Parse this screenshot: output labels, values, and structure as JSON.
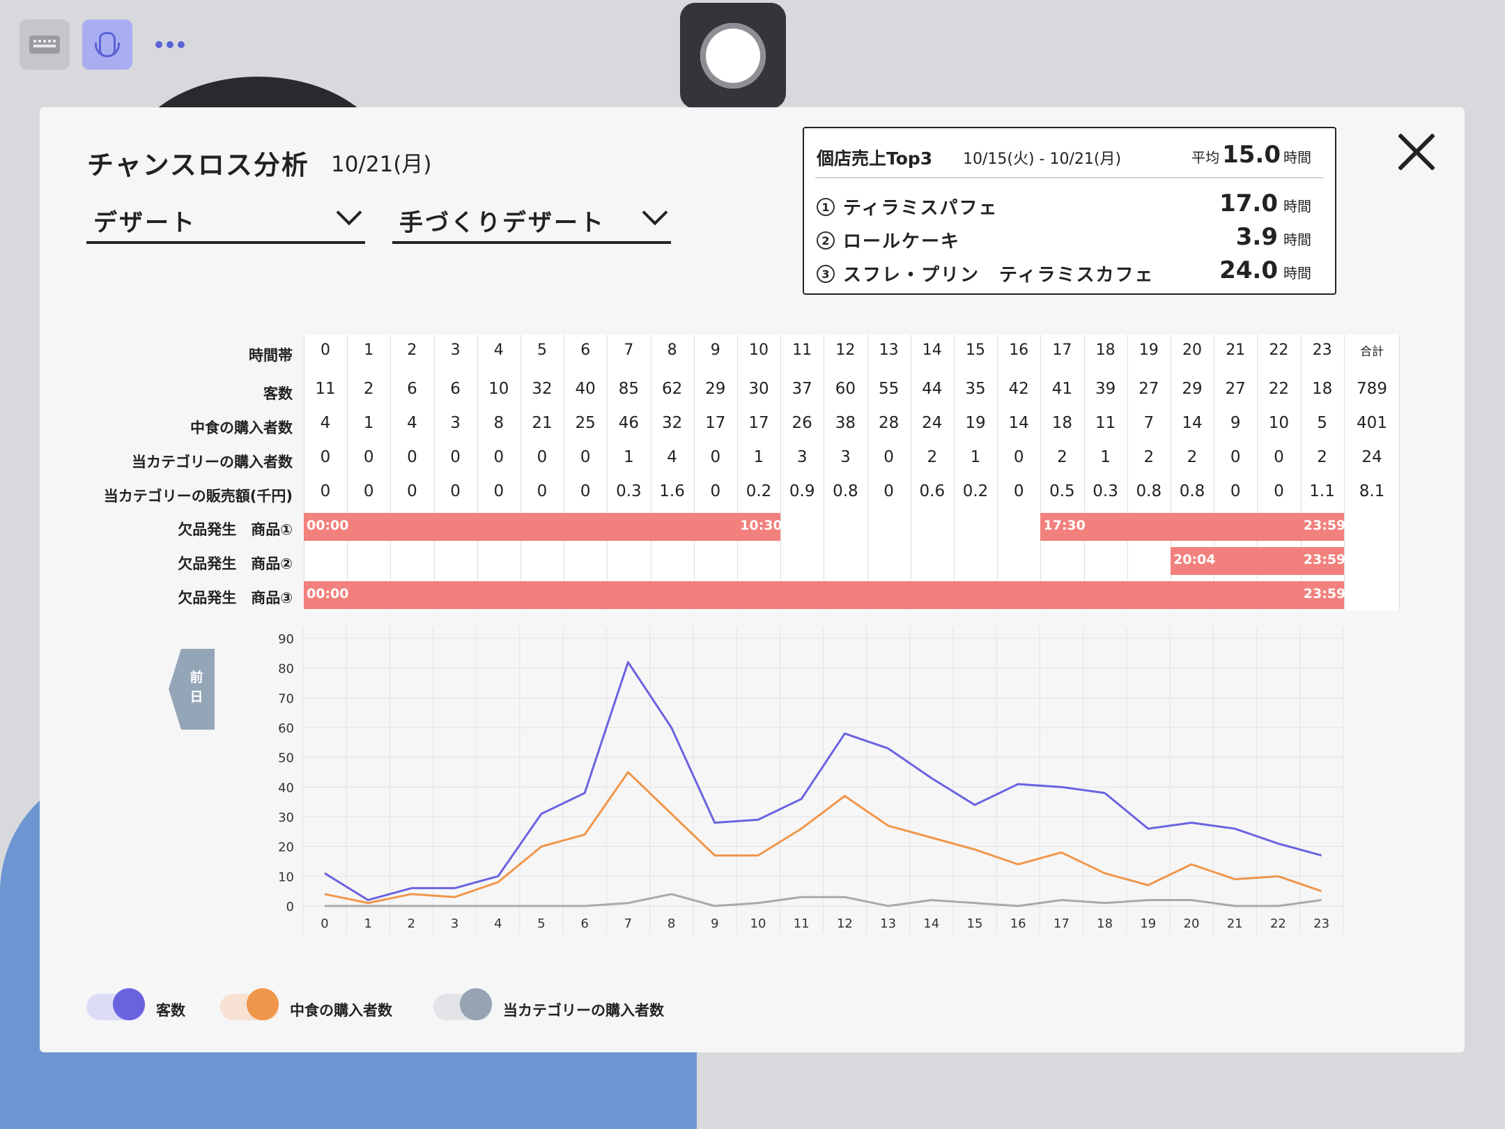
{
  "toolbar": {
    "keyboard_icon": "keyboard-icon",
    "mic_icon": "microphone-icon",
    "more_icon": "more-dots-icon",
    "record_icon": "record-icon"
  },
  "header": {
    "title": "チャンスロス分析",
    "date": "10/21(月)"
  },
  "filters": {
    "category": "デザート",
    "subcategory": "手づくりデザート"
  },
  "top3": {
    "title": "個店売上Top3",
    "range": "10/15(火) - 10/21(月)",
    "avg_label": "平均",
    "avg_value": "15.0",
    "unit": "時間",
    "items": [
      {
        "rank": "1",
        "name": "ティラミスパフェ",
        "value": "17.0"
      },
      {
        "rank": "2",
        "name": "ロールケーキ",
        "value": "3.9"
      },
      {
        "rank": "3",
        "name": "スフレ・プリン　ティラミスカフェ",
        "value": "24.0"
      }
    ]
  },
  "table": {
    "row_labels": {
      "hours": "時間帯",
      "customers": "客数",
      "lunch": "中食の購入者数",
      "category": "当カテゴリーの購入者数",
      "sales": "当カテゴリーの販売額(千円)",
      "stock1": "欠品発生　商品①",
      "stock2": "欠品発生　商品②",
      "stock3": "欠品発生　商品③"
    },
    "hours": [
      "0",
      "1",
      "2",
      "3",
      "4",
      "5",
      "6",
      "7",
      "8",
      "9",
      "10",
      "11",
      "12",
      "13",
      "14",
      "15",
      "16",
      "17",
      "18",
      "19",
      "20",
      "21",
      "22",
      "23"
    ],
    "sum_label": "合計",
    "customers": [
      "11",
      "2",
      "6",
      "6",
      "10",
      "32",
      "40",
      "85",
      "62",
      "29",
      "30",
      "37",
      "60",
      "55",
      "44",
      "35",
      "42",
      "41",
      "39",
      "27",
      "29",
      "27",
      "22",
      "18"
    ],
    "customers_total": "789",
    "lunch": [
      "4",
      "1",
      "4",
      "3",
      "8",
      "21",
      "25",
      "46",
      "32",
      "17",
      "17",
      "26",
      "38",
      "28",
      "24",
      "19",
      "14",
      "18",
      "11",
      "7",
      "14",
      "9",
      "10",
      "5"
    ],
    "lunch_total": "401",
    "category": [
      "0",
      "0",
      "0",
      "0",
      "0",
      "0",
      "0",
      "1",
      "4",
      "0",
      "1",
      "3",
      "3",
      "0",
      "2",
      "1",
      "0",
      "2",
      "1",
      "2",
      "2",
      "0",
      "0",
      "2"
    ],
    "category_total": "24",
    "sales": [
      "0",
      "0",
      "0",
      "0",
      "0",
      "0",
      "0",
      "0.3",
      "1.6",
      "0",
      "0.2",
      "0.9",
      "0.8",
      "0",
      "0.6",
      "0.2",
      "0",
      "0.5",
      "0.3",
      "0.8",
      "0.8",
      "0",
      "0",
      "1.1"
    ],
    "sales_total": "8.1",
    "stockouts": [
      {
        "segments": [
          {
            "from": 0,
            "to": 10.99,
            "start": "00:00",
            "end": "10:30"
          },
          {
            "from": 17,
            "to": 23.99,
            "start": "17:30",
            "end": "23:59"
          }
        ]
      },
      {
        "segments": [
          {
            "from": 20,
            "to": 23.99,
            "start": "20:04",
            "end": "23:59"
          }
        ]
      },
      {
        "segments": [
          {
            "from": 0,
            "to": 23.99,
            "start": "00:00",
            "end": "23:59"
          }
        ]
      }
    ]
  },
  "prev_day": {
    "label": "前日",
    "icon": "chevron-left-icon"
  },
  "chart_data": {
    "type": "line",
    "x": [
      0,
      1,
      2,
      3,
      4,
      5,
      6,
      7,
      8,
      9,
      10,
      11,
      12,
      13,
      14,
      15,
      16,
      17,
      18,
      19,
      20,
      21,
      22,
      23
    ],
    "ylim": [
      0,
      90
    ],
    "yticks": [
      0,
      10,
      20,
      30,
      40,
      50,
      60,
      70,
      80,
      90
    ],
    "grid": true,
    "series": [
      {
        "name": "客数",
        "color": "#6a63e0",
        "values": [
          11,
          2,
          6,
          6,
          10,
          31,
          38,
          82,
          60,
          28,
          29,
          36,
          58,
          53,
          43,
          34,
          41,
          40,
          38,
          26,
          28,
          26,
          21,
          17
        ]
      },
      {
        "name": "中食の購入者数",
        "color": "#f0964a",
        "values": [
          4,
          1,
          4,
          3,
          8,
          20,
          24,
          45,
          31,
          17,
          17,
          26,
          37,
          27,
          23,
          19,
          14,
          18,
          11,
          7,
          14,
          9,
          10,
          5
        ]
      },
      {
        "name": "当カテゴリーの購入者数",
        "color": "#a9a9ad",
        "values": [
          0,
          0,
          0,
          0,
          0,
          0,
          0,
          1,
          4,
          0,
          1,
          3,
          3,
          0,
          2,
          1,
          0,
          2,
          1,
          2,
          2,
          0,
          0,
          2
        ]
      }
    ]
  },
  "legend": [
    {
      "label": "客数",
      "color": "#6a63e0",
      "track": "#dcdcf6"
    },
    {
      "label": "中食の購入者数",
      "color": "#f0964a",
      "track": "#f6e1d2"
    },
    {
      "label": "当カテゴリーの購入者数",
      "color": "#95a3b3",
      "track": "#e2e4e8"
    }
  ]
}
